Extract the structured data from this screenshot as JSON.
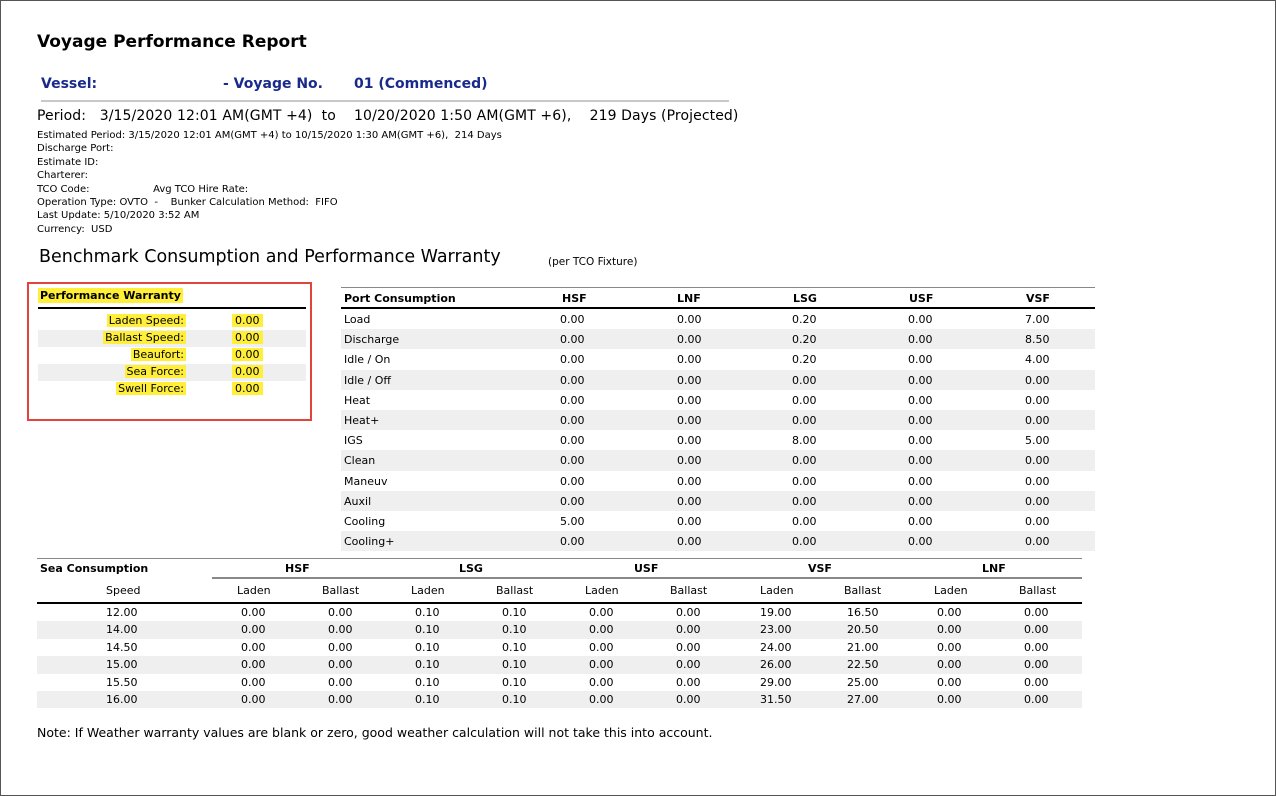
{
  "report": {
    "title": "Voyage Performance Report",
    "vessel_label": "Vessel:",
    "voyage_label": "- Voyage No.",
    "voyage_value": "01 (Commenced)",
    "period": "Period:   3/15/2020 12:01 AM(GMT +4)  to    10/20/2020 1:50 AM(GMT +6),    219 Days (Projected)",
    "meta": [
      "Estimated Period: 3/15/2020 12:01 AM(GMT +4) to 10/15/2020 1:30 AM(GMT +6),  214 Days",
      "Discharge Port:",
      "Estimate ID:",
      "Charterer:",
      "TCO Code:                    Avg TCO Hire Rate:",
      "Operation Type: OVTO  -    Bunker Calculation Method:  FIFO",
      "Last Update: 5/10/2020 3:52 AM",
      "Currency:  USD"
    ],
    "section_title": "Benchmark Consumption and Performance Warranty",
    "section_sub": "(per TCO Fixture)",
    "note": "Note: If Weather warranty values are blank or zero, good weather calculation will not take this into account."
  },
  "warranty": {
    "title": "Performance Warranty",
    "rows": [
      {
        "label": "Laden Speed:",
        "value": "0.00"
      },
      {
        "label": "Ballast Speed:",
        "value": "0.00"
      },
      {
        "label": "Beaufort:",
        "value": "0.00"
      },
      {
        "label": "Sea Force:",
        "value": "0.00"
      },
      {
        "label": "Swell Force:",
        "value": "0.00"
      }
    ]
  },
  "port": {
    "headers": [
      "Port Consumption",
      "HSF",
      "LNF",
      "LSG",
      "USF",
      "VSF"
    ],
    "rows": [
      [
        "Load",
        "0.00",
        "0.00",
        "0.20",
        "0.00",
        "7.00"
      ],
      [
        "Discharge",
        "0.00",
        "0.00",
        "0.20",
        "0.00",
        "8.50"
      ],
      [
        "Idle / On",
        "0.00",
        "0.00",
        "0.20",
        "0.00",
        "4.00"
      ],
      [
        "Idle / Off",
        "0.00",
        "0.00",
        "0.00",
        "0.00",
        "0.00"
      ],
      [
        "Heat",
        "0.00",
        "0.00",
        "0.00",
        "0.00",
        "0.00"
      ],
      [
        "Heat+",
        "0.00",
        "0.00",
        "0.00",
        "0.00",
        "0.00"
      ],
      [
        "IGS",
        "0.00",
        "0.00",
        "8.00",
        "0.00",
        "5.00"
      ],
      [
        "Clean",
        "0.00",
        "0.00",
        "0.00",
        "0.00",
        "0.00"
      ],
      [
        "Maneuv",
        "0.00",
        "0.00",
        "0.00",
        "0.00",
        "0.00"
      ],
      [
        "Auxil",
        "0.00",
        "0.00",
        "0.00",
        "0.00",
        "0.00"
      ],
      [
        "Cooling",
        "5.00",
        "0.00",
        "0.00",
        "0.00",
        "0.00"
      ],
      [
        "Cooling+",
        "0.00",
        "0.00",
        "0.00",
        "0.00",
        "0.00"
      ]
    ]
  },
  "sea": {
    "title": "Sea Consumption",
    "groups": [
      "HSF",
      "LSG",
      "USF",
      "VSF",
      "LNF"
    ],
    "subheaders": [
      "Speed",
      "Laden",
      "Ballast",
      "Laden",
      "Ballast",
      "Laden",
      "Ballast",
      "Laden",
      "Ballast",
      "Laden",
      "Ballast"
    ],
    "rows": [
      [
        "12.00",
        "0.00",
        "0.00",
        "0.10",
        "0.10",
        "0.00",
        "0.00",
        "19.00",
        "16.50",
        "0.00",
        "0.00"
      ],
      [
        "14.00",
        "0.00",
        "0.00",
        "0.10",
        "0.10",
        "0.00",
        "0.00",
        "23.00",
        "20.50",
        "0.00",
        "0.00"
      ],
      [
        "14.50",
        "0.00",
        "0.00",
        "0.10",
        "0.10",
        "0.00",
        "0.00",
        "24.00",
        "21.00",
        "0.00",
        "0.00"
      ],
      [
        "15.00",
        "0.00",
        "0.00",
        "0.10",
        "0.10",
        "0.00",
        "0.00",
        "26.00",
        "22.50",
        "0.00",
        "0.00"
      ],
      [
        "15.50",
        "0.00",
        "0.00",
        "0.10",
        "0.10",
        "0.00",
        "0.00",
        "29.00",
        "25.00",
        "0.00",
        "0.00"
      ],
      [
        "16.00",
        "0.00",
        "0.00",
        "0.10",
        "0.10",
        "0.00",
        "0.00",
        "31.50",
        "27.00",
        "0.00",
        "0.00"
      ]
    ]
  },
  "colors": {
    "highlight": "#ffef3a",
    "vessel_text": "#1a2a8c",
    "warranty_box_border": "#e0453c",
    "row_alt": "#efefef"
  }
}
